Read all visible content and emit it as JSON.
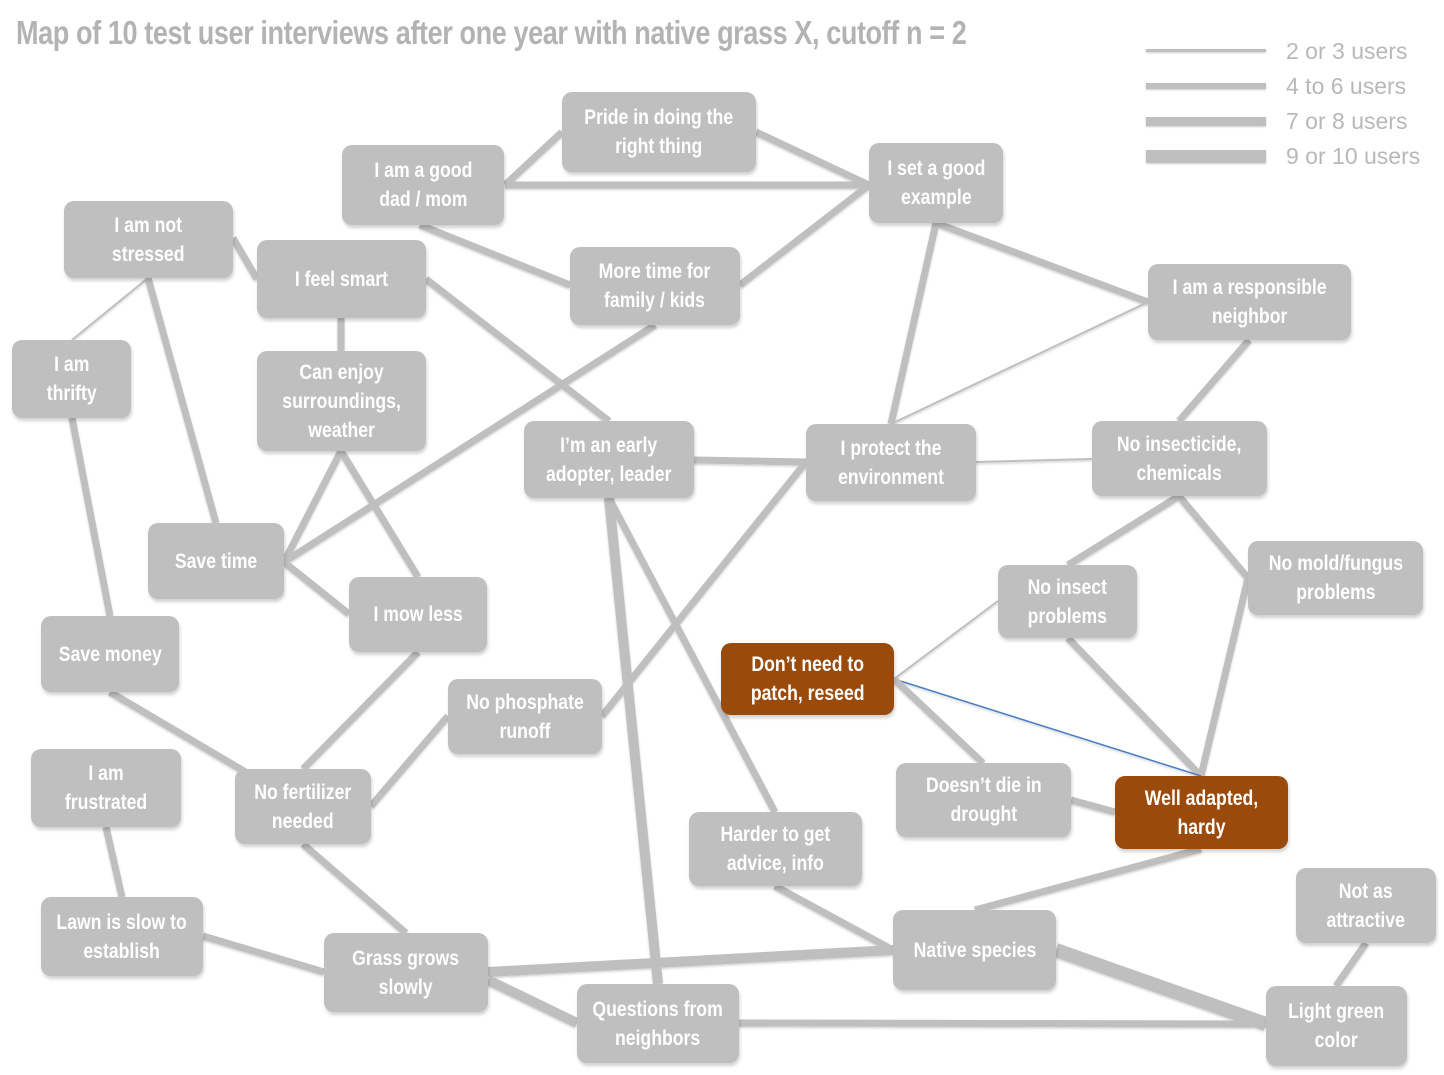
{
  "title": "Map of 10 test user interviews after one year with native grass X, cutoff n = 2",
  "colors": {
    "node": "#bfbfbf",
    "highlight_node": "#9a4a0a",
    "edge": "#bfbfbf",
    "highlight_edge": "#4a7fc0",
    "text": "#ffffff",
    "title": "#b3b3b3"
  },
  "legend": [
    {
      "label": "2 or 3 users",
      "weight": 1
    },
    {
      "label": "4 to 6 users",
      "weight": 2
    },
    {
      "label": "7 or 8 users",
      "weight": 3
    },
    {
      "label": "9 or 10 users",
      "weight": 4
    }
  ],
  "nodes": [
    {
      "id": "pride",
      "label": "Pride in doing the\nright thing"
    },
    {
      "id": "good_parent",
      "label": "I am a good\ndad / mom"
    },
    {
      "id": "good_example",
      "label": "I set a good\nexample"
    },
    {
      "id": "not_stressed",
      "label": "I am not\nstressed"
    },
    {
      "id": "feel_smart",
      "label": "I feel smart"
    },
    {
      "id": "more_time",
      "label": "More time for\nfamily / kids"
    },
    {
      "id": "responsible",
      "label": "I am a responsible\nneighbor"
    },
    {
      "id": "thrifty",
      "label": "I am\nthrifty"
    },
    {
      "id": "enjoy",
      "label": "Can enjoy\nsurroundings,\nweather"
    },
    {
      "id": "early_adopter",
      "label": "I’m an early\nadopter, leader"
    },
    {
      "id": "protect_env",
      "label": "I protect the\nenvironment"
    },
    {
      "id": "no_insecticide",
      "label": "No insecticide,\nchemicals"
    },
    {
      "id": "save_time",
      "label": "Save time"
    },
    {
      "id": "no_insect",
      "label": "No insect\nproblems"
    },
    {
      "id": "no_mold",
      "label": "No mold/fungus\nproblems"
    },
    {
      "id": "mow_less",
      "label": "I mow less"
    },
    {
      "id": "save_money",
      "label": "Save money"
    },
    {
      "id": "no_patch",
      "label": "Don’t need to\npatch, reseed",
      "highlight": true
    },
    {
      "id": "no_phosphate",
      "label": "No phosphate\nrunoff"
    },
    {
      "id": "frustrated",
      "label": "I am\nfrustrated"
    },
    {
      "id": "no_fertilizer",
      "label": "No fertilizer\nneeded"
    },
    {
      "id": "no_drought_death",
      "label": "Doesn’t die in\ndrought"
    },
    {
      "id": "well_adapted",
      "label": "Well adapted,\nhardy",
      "highlight": true
    },
    {
      "id": "harder_advice",
      "label": "Harder to get\nadvice, info"
    },
    {
      "id": "not_attractive",
      "label": "Not as\nattractive"
    },
    {
      "id": "slow_establish",
      "label": "Lawn is slow to\nestablish"
    },
    {
      "id": "grows_slowly",
      "label": "Grass grows\nslowly"
    },
    {
      "id": "native",
      "label": "Native species"
    },
    {
      "id": "questions",
      "label": "Questions from\nneighbors"
    },
    {
      "id": "light_green",
      "label": "Light green\ncolor"
    }
  ],
  "edges": [
    {
      "from": "good_parent",
      "to": "pride",
      "users": "4 to 6"
    },
    {
      "from": "good_parent",
      "to": "good_example",
      "users": "4 to 6"
    },
    {
      "from": "pride",
      "to": "good_example",
      "users": "4 to 6"
    },
    {
      "from": "good_parent",
      "to": "more_time",
      "users": "4 to 6"
    },
    {
      "from": "more_time",
      "to": "good_example",
      "users": "4 to 6"
    },
    {
      "from": "good_example",
      "to": "responsible",
      "users": "4 to 6"
    },
    {
      "from": "good_example",
      "to": "protect_env",
      "users": "4 to 6"
    },
    {
      "from": "protect_env",
      "to": "responsible",
      "users": "2 or 3"
    },
    {
      "from": "responsible",
      "to": "no_insecticide",
      "users": "4 to 6"
    },
    {
      "from": "not_stressed",
      "to": "feel_smart",
      "users": "4 to 6"
    },
    {
      "from": "not_stressed",
      "to": "thrifty",
      "users": "2 or 3"
    },
    {
      "from": "not_stressed",
      "to": "save_time",
      "users": "4 to 6"
    },
    {
      "from": "feel_smart",
      "to": "enjoy",
      "users": "4 to 6"
    },
    {
      "from": "feel_smart",
      "to": "early_adopter",
      "users": "4 to 6"
    },
    {
      "from": "more_time",
      "to": "save_time",
      "users": "4 to 6"
    },
    {
      "from": "enjoy",
      "to": "save_time",
      "users": "4 to 6"
    },
    {
      "from": "enjoy",
      "to": "mow_less",
      "users": "4 to 6"
    },
    {
      "from": "save_time",
      "to": "mow_less",
      "users": "4 to 6"
    },
    {
      "from": "thrifty",
      "to": "save_money",
      "users": "4 to 6"
    },
    {
      "from": "early_adopter",
      "to": "protect_env",
      "users": "4 to 6"
    },
    {
      "from": "protect_env",
      "to": "no_insecticide",
      "users": "2 or 3"
    },
    {
      "from": "protect_env",
      "to": "no_phosphate",
      "users": "4 to 6"
    },
    {
      "from": "early_adopter",
      "to": "questions",
      "users": "7 or 8"
    },
    {
      "from": "early_adopter",
      "to": "harder_advice",
      "users": "4 to 6"
    },
    {
      "from": "no_insecticide",
      "to": "no_insect",
      "users": "4 to 6"
    },
    {
      "from": "no_insecticide",
      "to": "no_mold",
      "users": "4 to 6"
    },
    {
      "from": "no_insect",
      "to": "no_patch",
      "users": "2 or 3"
    },
    {
      "from": "no_insect",
      "to": "well_adapted",
      "users": "4 to 6"
    },
    {
      "from": "no_mold",
      "to": "well_adapted",
      "users": "4 to 6"
    },
    {
      "from": "no_patch",
      "to": "well_adapted",
      "users": "2 or 3",
      "highlight": true
    },
    {
      "from": "no_patch",
      "to": "no_drought_death",
      "users": "4 to 6"
    },
    {
      "from": "no_drought_death",
      "to": "well_adapted",
      "users": "4 to 6"
    },
    {
      "from": "well_adapted",
      "to": "native",
      "users": "4 to 6"
    },
    {
      "from": "mow_less",
      "to": "no_fertilizer",
      "users": "4 to 6"
    },
    {
      "from": "save_money",
      "to": "no_fertilizer",
      "users": "4 to 6"
    },
    {
      "from": "no_phosphate",
      "to": "no_fertilizer",
      "users": "4 to 6"
    },
    {
      "from": "frustrated",
      "to": "slow_establish",
      "users": "4 to 6"
    },
    {
      "from": "no_fertilizer",
      "to": "grows_slowly",
      "users": "4 to 6"
    },
    {
      "from": "slow_establish",
      "to": "grows_slowly",
      "users": "4 to 6"
    },
    {
      "from": "grows_slowly",
      "to": "native",
      "users": "7 or 8"
    },
    {
      "from": "grows_slowly",
      "to": "questions",
      "users": "7 or 8"
    },
    {
      "from": "harder_advice",
      "to": "native",
      "users": "4 to 6"
    },
    {
      "from": "native",
      "to": "light_green",
      "users": "9 or 10"
    },
    {
      "from": "questions",
      "to": "light_green",
      "users": "4 to 6"
    },
    {
      "from": "not_attractive",
      "to": "light_green",
      "users": "4 to 6"
    }
  ]
}
